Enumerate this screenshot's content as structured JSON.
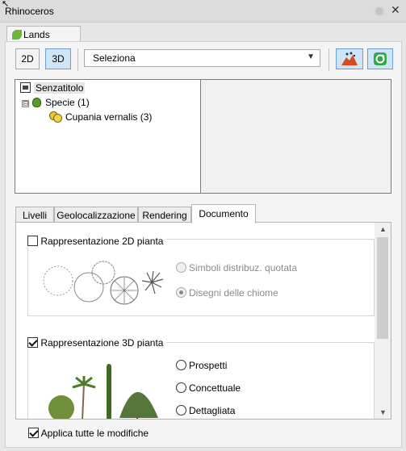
{
  "window": {
    "title": "Rhinoceros"
  },
  "panel": {
    "tab_label": "Lands Design"
  },
  "toolbar": {
    "btn_2d": "2D",
    "btn_3d": "3D",
    "select_value": "Seleziona"
  },
  "tree": {
    "root": "Senzatitolo",
    "expander": "⊟",
    "group": "Specie (1)",
    "item": "Cupania vernalis (3)"
  },
  "tabs": [
    "Livelli",
    "Geolocalizzazione",
    "Rendering",
    "Documento"
  ],
  "documento": {
    "rep2d": {
      "label": "Rappresentazione 2D pianta",
      "checked": false,
      "options": [
        "Simboli distribuz. quotata",
        "Disegni delle chiome"
      ],
      "selected": "Disegni delle chiome"
    },
    "rep3d": {
      "label": "Rappresentazione 3D pianta",
      "checked": true,
      "options": [
        "Prospetti",
        "Concettuale",
        "Dettagliata"
      ]
    }
  },
  "footer": {
    "apply_label": "Applica tutte le modifiche",
    "checked": true
  },
  "colors": {
    "active_button": "#cfe4f7",
    "active_border": "#6a9fd4"
  }
}
